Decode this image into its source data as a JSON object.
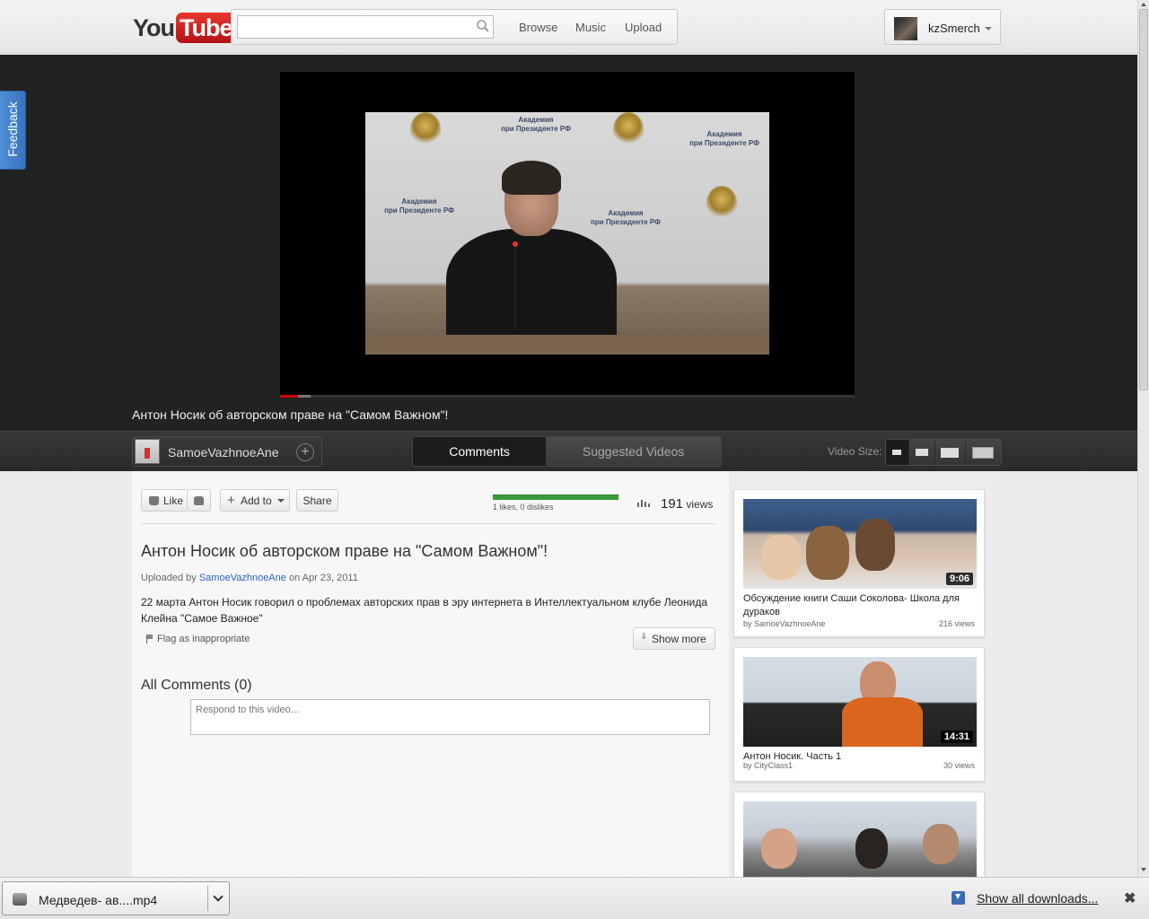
{
  "header": {
    "logo_you": "You",
    "logo_tube": "Tube",
    "search": {
      "placeholder": ""
    },
    "nav": {
      "browse": "Browse",
      "music": "Music",
      "upload": "Upload"
    },
    "user": {
      "name": "kzSmerch"
    }
  },
  "feedback": {
    "label": "Feedback"
  },
  "player": {
    "title": "Антон Носик об авторском праве на \"Самом Важном\"!",
    "progress_played_percent": 3
  },
  "channel_bar": {
    "channel_name": "SamoeVazhnoeAne",
    "subscribe_symbol": "+",
    "tabs": [
      "Comments",
      "Suggested Videos"
    ],
    "video_size_label": "Video Size:"
  },
  "actions": {
    "like": "Like",
    "add_to": "Add to",
    "share": "Share"
  },
  "stats": {
    "likes_text": "1 likes, 0 dislikes",
    "views_count": "191",
    "views_word": "views"
  },
  "video": {
    "title": "Антон Носик об авторском праве на \"Самом Важном\"!",
    "uploaded_prefix": "Uploaded by",
    "uploader": "SamoeVazhnoeAne",
    "uploaded_on": "on Apr 23, 2011",
    "description": "22 марта Антон Носик говорил о проблемах авторских прав в эру интернета в Интеллектуальном клубе Леонида Клейна \"Самое Важное\"",
    "flag": "Flag as inappropriate",
    "show_more": "Show more"
  },
  "comments": {
    "heading": "All Comments (0)",
    "placeholder": "Respond to this video..."
  },
  "suggested": [
    {
      "duration": "9:06",
      "title": "Обсуждение книги Саши Соколова- Школа для дураков",
      "by": "by SamoeVazhnoeAne",
      "views": "216 views"
    },
    {
      "duration": "14:31",
      "title": "Антон Носик. Часть 1",
      "by": "by CityClass1",
      "views": "30 views"
    },
    {
      "duration": "",
      "title": "",
      "by": "",
      "views": ""
    }
  ],
  "downloads": {
    "file_name": "Медведев- ав....mp4",
    "show_all": "Show all downloads..."
  },
  "colors": {
    "accent_red": "#cc181e",
    "link_blue": "#2a62c6",
    "ratio_green": "#3a9a3a"
  }
}
